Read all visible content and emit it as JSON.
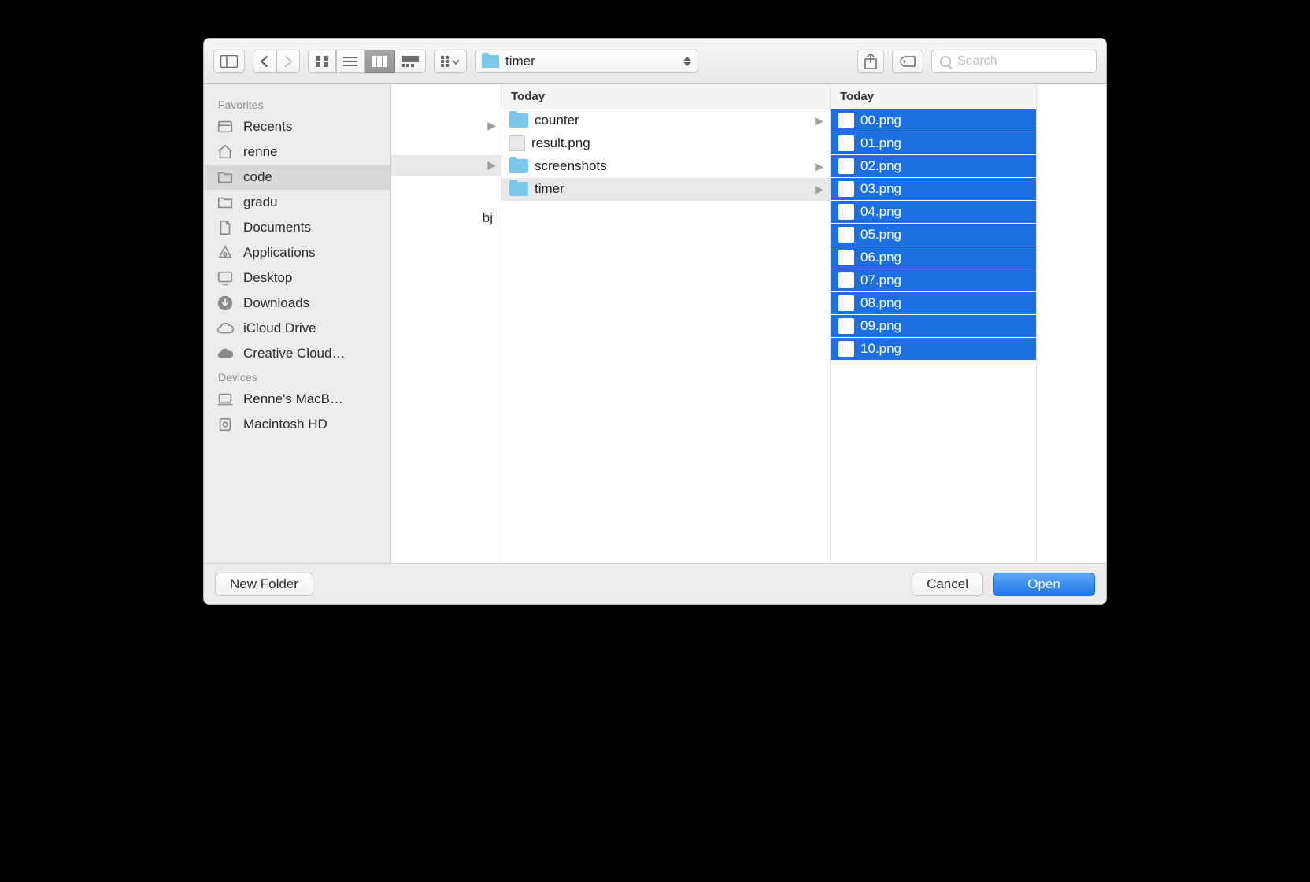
{
  "toolbar": {
    "path_label": "timer",
    "search_placeholder": "Search"
  },
  "sidebar": {
    "sections": [
      {
        "title": "Favorites",
        "items": [
          {
            "label": "Recents",
            "icon": "recents-icon",
            "selected": false
          },
          {
            "label": "renne",
            "icon": "home-icon",
            "selected": false
          },
          {
            "label": "code",
            "icon": "folder-icon",
            "selected": true
          },
          {
            "label": "gradu",
            "icon": "folder-icon",
            "selected": false
          },
          {
            "label": "Documents",
            "icon": "document-icon",
            "selected": false
          },
          {
            "label": "Applications",
            "icon": "applications-icon",
            "selected": false
          },
          {
            "label": "Desktop",
            "icon": "desktop-icon",
            "selected": false
          },
          {
            "label": "Downloads",
            "icon": "downloads-icon",
            "selected": false
          },
          {
            "label": "iCloud Drive",
            "icon": "icloud-icon",
            "selected": false
          },
          {
            "label": "Creative Cloud…",
            "icon": "creative-cloud-icon",
            "selected": false
          }
        ]
      },
      {
        "title": "Devices",
        "items": [
          {
            "label": "Renne's MacB…",
            "icon": "laptop-icon",
            "selected": false
          },
          {
            "label": "Macintosh HD",
            "icon": "disk-icon",
            "selected": false
          }
        ]
      }
    ]
  },
  "columns": {
    "col0": {
      "rows": [
        {
          "fragment": "",
          "has_arrow": true,
          "otherfrag": ""
        },
        {
          "fragment": "",
          "has_arrow": true,
          "otherfrag": "",
          "selected": true
        },
        {
          "fragment": "bj",
          "has_arrow": false,
          "otherfrag": ""
        }
      ]
    },
    "col1": {
      "header": "Today",
      "rows": [
        {
          "label": "counter",
          "type": "folder",
          "has_arrow": true,
          "selected": false
        },
        {
          "label": "result.png",
          "type": "png",
          "has_arrow": false,
          "selected": false
        },
        {
          "label": "screenshots",
          "type": "folder",
          "has_arrow": true,
          "selected": false
        },
        {
          "label": "timer",
          "type": "folder",
          "has_arrow": true,
          "selected": true
        }
      ]
    },
    "col2": {
      "header": "Today",
      "rows": [
        {
          "label": "00.png",
          "type": "png",
          "selected": true
        },
        {
          "label": "01.png",
          "type": "png",
          "selected": true
        },
        {
          "label": "02.png",
          "type": "png",
          "selected": true
        },
        {
          "label": "03.png",
          "type": "png",
          "selected": true
        },
        {
          "label": "04.png",
          "type": "png",
          "selected": true
        },
        {
          "label": "05.png",
          "type": "png",
          "selected": true
        },
        {
          "label": "06.png",
          "type": "png",
          "selected": true
        },
        {
          "label": "07.png",
          "type": "png",
          "selected": true
        },
        {
          "label": "08.png",
          "type": "png",
          "selected": true
        },
        {
          "label": "09.png",
          "type": "png",
          "selected": true
        },
        {
          "label": "10.png",
          "type": "png",
          "selected": true
        }
      ]
    }
  },
  "footer": {
    "new_folder": "New Folder",
    "cancel": "Cancel",
    "open": "Open"
  }
}
